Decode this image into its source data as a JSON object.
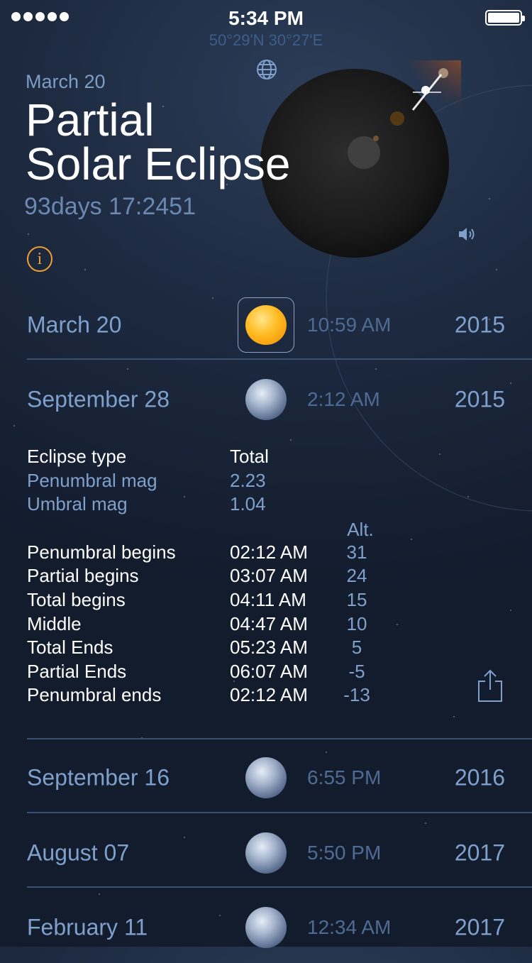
{
  "status_bar": {
    "time": "5:34 PM"
  },
  "location": {
    "coordinates": "50°29'N 30°27'E"
  },
  "hero": {
    "date": "March 20",
    "title_line1": "Partial",
    "title_line2": "Solar Eclipse",
    "countdown": "93days 17:2451"
  },
  "icons": {
    "globe": "globe-icon",
    "speaker": "speaker-icon",
    "info": "info-icon",
    "share": "share-icon",
    "info_glyph": "i"
  },
  "colors": {
    "accent": "#f0a030",
    "label_blue": "#7ea0cb",
    "time_blue": "#4e6b94",
    "background": "#1d2a40"
  },
  "eclipses": [
    {
      "date": "March 20",
      "time": "10:59 AM",
      "year": "2015",
      "type": "sun",
      "selected": true
    },
    {
      "date": "September 28",
      "time": "2:12 AM",
      "year": "2015",
      "type": "moon",
      "expanded": true
    },
    {
      "date": "September 16",
      "time": "6:55 PM",
      "year": "2016",
      "type": "moon"
    },
    {
      "date": "August 07",
      "time": "5:50 PM",
      "year": "2017",
      "type": "moon"
    },
    {
      "date": "February 11",
      "time": "12:34 AM",
      "year": "2017",
      "type": "moon"
    }
  ],
  "details": {
    "eclipse_type_label": "Eclipse type",
    "eclipse_type_value": "Total",
    "penumbral_mag_label": "Penumbral mag",
    "penumbral_mag_value": "2.23",
    "umbral_mag_label": "Umbral mag",
    "umbral_mag_value": "1.04",
    "alt_header": "Alt.",
    "phases": [
      {
        "label": "Penumbral begins",
        "time": "02:12 AM",
        "alt": "31"
      },
      {
        "label": "Partial begins",
        "time": "03:07 AM",
        "alt": "24"
      },
      {
        "label": "Total begins",
        "time": "04:11 AM",
        "alt": "15"
      },
      {
        "label": "Middle",
        "time": "04:47 AM",
        "alt": "10"
      },
      {
        "label": "Total Ends",
        "time": "05:23 AM",
        "alt": "5"
      },
      {
        "label": "Partial Ends",
        "time": "06:07 AM",
        "alt": "-5"
      },
      {
        "label": "Penumbral ends",
        "time": "02:12 AM",
        "alt": "-13"
      }
    ]
  }
}
